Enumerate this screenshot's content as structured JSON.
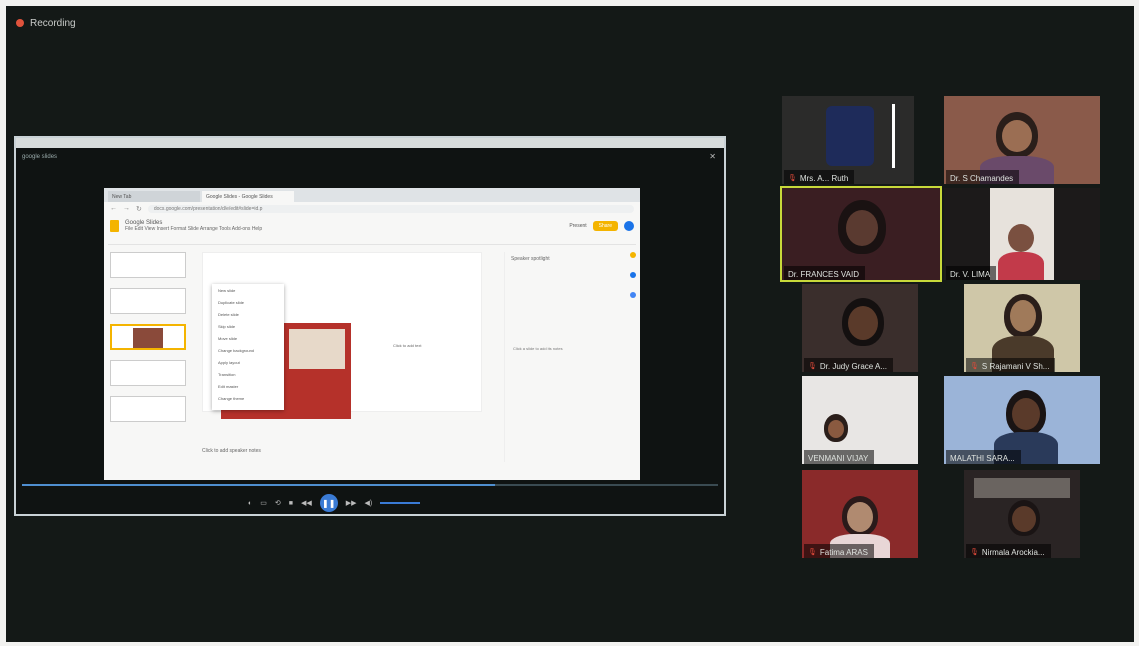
{
  "recording": {
    "label": "Recording"
  },
  "shared_screen": {
    "window_title": "google slides",
    "browser": {
      "tabs": [
        "New Tab",
        "Google Slides - Google Slides"
      ],
      "url": "docs.google.com/presentation/d/e/edit#slide=id.p",
      "app_name": "Google Slides",
      "menus": "File  Edit  View  Insert  Format  Slide  Arrange  Tools  Add-ons  Help",
      "present_label": "Present",
      "share_label": "Share"
    },
    "context_menu": [
      "New slide",
      "Duplicate slide",
      "Delete slide",
      "Skip slide",
      "Move slide",
      "Change background",
      "Apply layout",
      "Transition",
      "Edit master",
      "Change theme"
    ],
    "canvas_placeholder": "Click to add text",
    "notes_placeholder": "Click to add speaker notes",
    "side_panel": {
      "title": "Speaker spotlight",
      "text": "Click a slide to add its notes"
    }
  },
  "participants": [
    {
      "name": "Mrs. A... Ruth",
      "active": false,
      "shirt": "#1f2a5a",
      "bg": "#1e2b5a"
    },
    {
      "name": "Dr. S Chamandes",
      "active": false,
      "shirt": "#6a4a6a",
      "bg": "#8a5a4a"
    },
    {
      "name": "Dr. FRANCES VAID",
      "active": true,
      "shirt": "#2a1e20",
      "bg": "#3a1e22"
    },
    {
      "name": "Dr. V. LIMA",
      "active": false,
      "shirt": "#c23a4a",
      "bg": "#e7e2dc"
    },
    {
      "name": "Dr. Judy Grace A...",
      "active": false,
      "shirt": "#2a1a1a",
      "bg": "#3a2e2c"
    },
    {
      "name": "S Rajamani V Sh...",
      "active": false,
      "shirt": "#4a3a2a",
      "bg": "#cfc7a8"
    },
    {
      "name": "VENMANI VIJAY",
      "active": false,
      "shirt": "#3a2b2b",
      "bg": "#e8e6e4"
    },
    {
      "name": "MALATHI SARA...",
      "active": false,
      "shirt": "#2a3a5a",
      "bg": "#9bb4d8"
    },
    {
      "name": "Fatima ARAS",
      "active": false,
      "shirt": "#e8d6d6",
      "bg": "#8a2a2a"
    },
    {
      "name": "Nirmala Arockia...",
      "active": false,
      "shirt": "#4a3a2a",
      "bg": "#2a2424"
    }
  ]
}
